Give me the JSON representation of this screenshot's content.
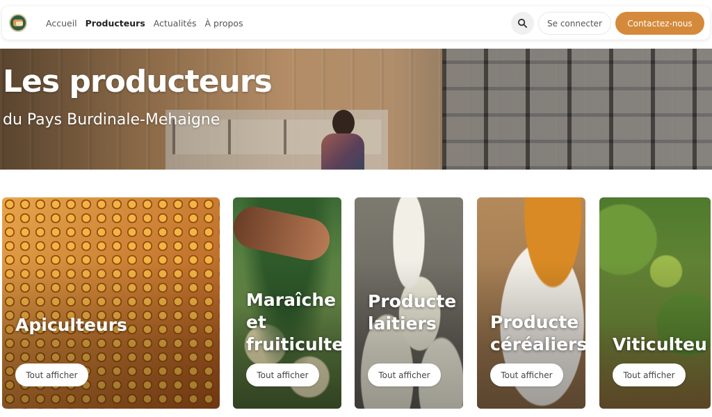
{
  "nav": {
    "links": [
      {
        "label": "Accueil",
        "active": false
      },
      {
        "label": "Producteurs",
        "active": true
      },
      {
        "label": "Actualités",
        "active": false
      },
      {
        "label": "À propos",
        "active": false
      }
    ],
    "search_icon": "search-icon",
    "login_label": "Se connecter",
    "contact_label": "Contactez-nous",
    "accent_color": "#d58a3b"
  },
  "hero": {
    "title": "Les producteurs",
    "subtitle": "du Pays Burdinale-Mehaigne"
  },
  "cards": [
    {
      "title": "Apiculteurs",
      "button": "Tout afficher"
    },
    {
      "title": "Maraîche\net\nfruiticulte",
      "button": "Tout afficher"
    },
    {
      "title": "Producte\nlaitiers",
      "button": "Tout afficher"
    },
    {
      "title": "Producte\ncéréaliers",
      "button": "Tout afficher"
    },
    {
      "title": "Viticulteu",
      "button": "Tout afficher"
    }
  ]
}
